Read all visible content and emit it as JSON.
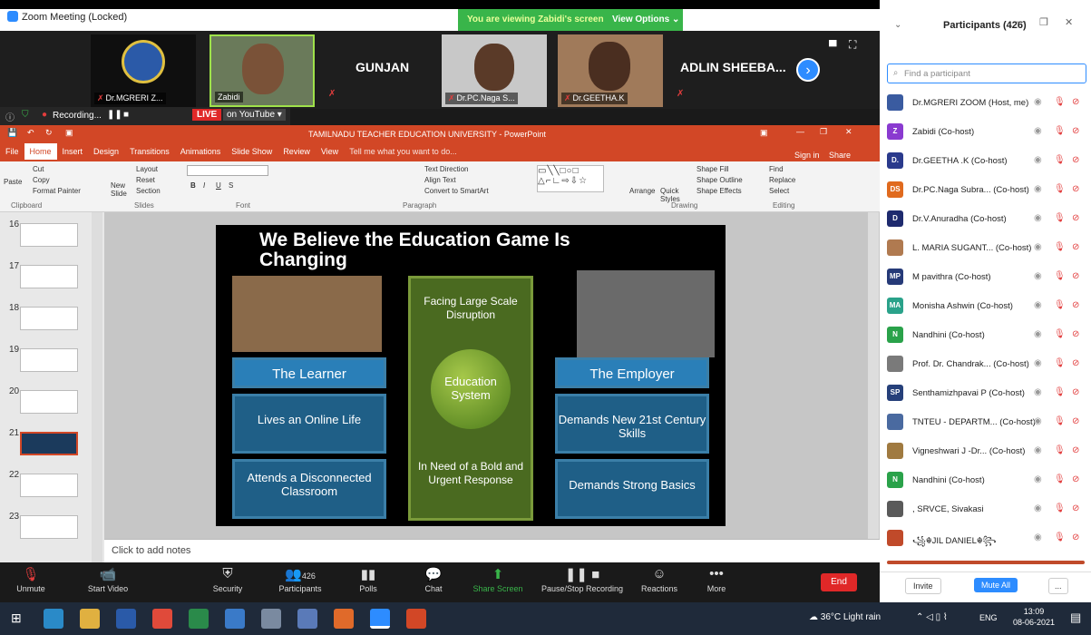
{
  "window": {
    "title": "Zoom Meeting (Locked)",
    "controls": [
      "—",
      "❐",
      "✕"
    ]
  },
  "banner": {
    "text": "You are viewing Zabidi's screen",
    "view_options": "View Options ⌄"
  },
  "videos": [
    {
      "name": "Dr.MGRERI Z...",
      "muted": true
    },
    {
      "name": "Zabidi",
      "muted": false
    },
    {
      "label": "GUNJAN"
    },
    {
      "name": "Dr.PC.Naga S...",
      "muted": true
    },
    {
      "name": "Dr.GEETHA.K",
      "muted": true
    },
    {
      "label": "ADLIN SHEEBA..."
    }
  ],
  "recording": {
    "label": "Recording...",
    "live": "LIVE",
    "on": "on YouTube ▾"
  },
  "ppt": {
    "title": "TAMILNADU TEACHER EDUCATION UNIVERSITY - PowerPoint",
    "signin": "Sign in",
    "share": "Share",
    "tabs": [
      "File",
      "Home",
      "Insert",
      "Design",
      "Transitions",
      "Animations",
      "Slide Show",
      "Review",
      "View",
      "Tell me what you want to do..."
    ],
    "ribbon": {
      "clipboard": {
        "paste": "Paste",
        "cut": "Cut",
        "copy": "Copy",
        "format_painter": "Format Painter",
        "label": "Clipboard"
      },
      "slides": {
        "new_slide": "New Slide",
        "layout": "Layout",
        "reset": "Reset",
        "section": "Section",
        "label": "Slides"
      },
      "font": {
        "label": "Font"
      },
      "paragraph": {
        "text_direction": "Text Direction",
        "align_text": "Align Text",
        "convert": "Convert to SmartArt",
        "label": "Paragraph"
      },
      "drawing": {
        "arrange": "Arrange",
        "quick": "Quick Styles",
        "fill": "Shape Fill",
        "outline": "Shape Outline",
        "effects": "Shape Effects",
        "label": "Drawing"
      },
      "editing": {
        "find": "Find",
        "replace": "Replace",
        "select": "Select",
        "label": "Editing"
      }
    },
    "thumb_numbers": [
      "16",
      "17",
      "18",
      "19",
      "20",
      "21",
      "22",
      "23"
    ],
    "notes": "Click to add notes",
    "slide": {
      "title_l1": "We Believe the Education Game Is",
      "title_l2": "Changing",
      "learner": "The Learner",
      "learner_1": "Lives an Online Life",
      "learner_2": "Attends a Disconnected Classroom",
      "center_top": "Facing Large Scale Disruption",
      "center_mid": "Education System",
      "center_bot": "In Need of a Bold and Urgent Response",
      "employer": "The Employer",
      "employer_1": "Demands New 21st Century Skills",
      "employer_2": "Demands Strong Basics"
    }
  },
  "controls": {
    "unmute": "Unmute",
    "video": "Start Video",
    "security": "Security",
    "participants": "Participants",
    "participants_count": "426",
    "polls": "Polls",
    "chat": "Chat",
    "share": "Share Screen",
    "rec": "Pause/Stop Recording",
    "reactions": "Reactions",
    "more": "More",
    "end": "End"
  },
  "participants_panel": {
    "title": "Participants (426)",
    "search_placeholder": "Find a participant",
    "list": [
      {
        "name": "Dr.MGRERI ZOOM (Host, me)",
        "av": "",
        "color": "#3a5ba0"
      },
      {
        "name": "Zabidi (Co-host)",
        "av": "Z",
        "color": "#8a3ad0"
      },
      {
        "name": "Dr.GEETHA .K (Co-host)",
        "av": "D.",
        "color": "#2a3a8c"
      },
      {
        "name": "Dr.PC.Naga Subra... (Co-host)",
        "av": "DS",
        "color": "#e06a1e"
      },
      {
        "name": "Dr.V.Anuradha (Co-host)",
        "av": "D",
        "color": "#1e2a6e"
      },
      {
        "name": "L. MARIA SUGANT... (Co-host)",
        "av": "",
        "color": "#b07a50"
      },
      {
        "name": "M pavithra (Co-host)",
        "av": "MP",
        "color": "#263a78"
      },
      {
        "name": "Monisha Ashwin (Co-host)",
        "av": "MA",
        "color": "#2aa28a"
      },
      {
        "name": "Nandhini (Co-host)",
        "av": "N",
        "color": "#2aa24a"
      },
      {
        "name": "Prof. Dr. Chandrak... (Co-host)",
        "av": "",
        "color": "#7a7a7a"
      },
      {
        "name": "Senthamizhpavai P (Co-host)",
        "av": "SP",
        "color": "#26407a"
      },
      {
        "name": "TNTEU - DEPARTM... (Co-host)",
        "av": "",
        "color": "#4a6aa0"
      },
      {
        "name": "Vigneshwari J -Dr... (Co-host)",
        "av": "",
        "color": "#a07a40"
      },
      {
        "name": "Nandhini (Co-host)",
        "av": "N",
        "color": "#2aa24a"
      },
      {
        "name": ", SRVCE, Sivakasi",
        "av": "",
        "color": "#5a5a5a"
      },
      {
        "name": "꧁☬JIL DANIEL☬꧂",
        "av": "",
        "color": "#c04a2a"
      }
    ],
    "invite": "Invite",
    "mute_all": "Mute All",
    "more": "..."
  },
  "taskbar": {
    "weather": "36°C Light rain",
    "lang": "ENG",
    "time": "13:09",
    "date": "08-06-2021"
  }
}
